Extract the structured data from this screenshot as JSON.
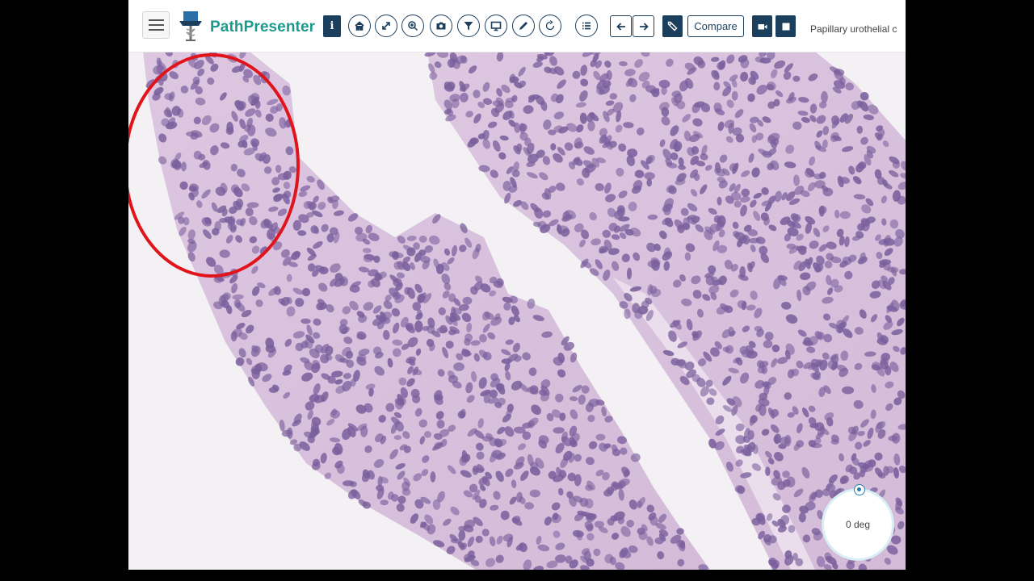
{
  "app": {
    "brand": "PathPresenter",
    "slide_title": "Papillary urothelial c"
  },
  "toolbar": {
    "info_icon": "info-icon",
    "buttons": [
      {
        "name": "home-icon"
      },
      {
        "name": "expand-icon"
      },
      {
        "name": "zoom-icon"
      },
      {
        "name": "camera-icon"
      },
      {
        "name": "filter-icon"
      },
      {
        "name": "monitor-icon"
      },
      {
        "name": "pencil-icon"
      },
      {
        "name": "rotate-icon"
      },
      {
        "name": "list-icon"
      }
    ],
    "prev_icon": "arrow-left-icon",
    "next_icon": "arrow-right-icon",
    "tag_icon": "tag-icon",
    "compare_label": "Compare",
    "video_icon": "video-camera-icon",
    "stop_icon": "stop-icon"
  },
  "viewer": {
    "annotation_color": "#e0141a",
    "tissue_color": "#d9c3de",
    "nucleus_color": "#7a5f9c"
  },
  "rotation": {
    "label": "0 deg"
  }
}
